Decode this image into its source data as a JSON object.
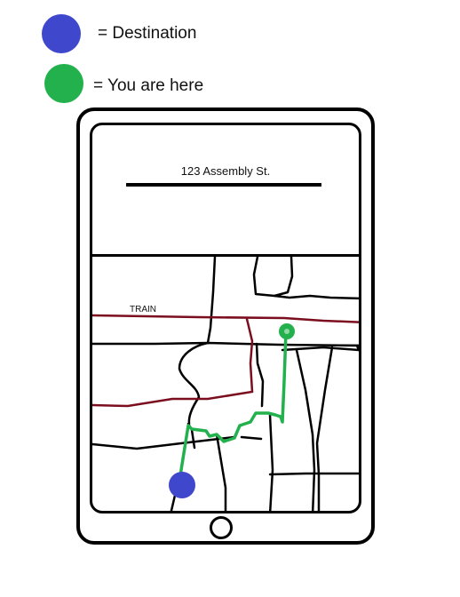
{
  "legend": {
    "destination": {
      "label": "= Destination",
      "color": "#3f48cc",
      "icon": "destination-dot-icon"
    },
    "current": {
      "label": "= You are here",
      "color": "#22b14c",
      "icon": "you-are-here-dot-icon"
    }
  },
  "address": {
    "text": "123 Assembly St."
  },
  "map": {
    "train_label": "TRAIN",
    "colors": {
      "road": "#000000",
      "train": "#7b0e1e",
      "route": "#22b14c",
      "destination": "#3f48cc"
    }
  }
}
